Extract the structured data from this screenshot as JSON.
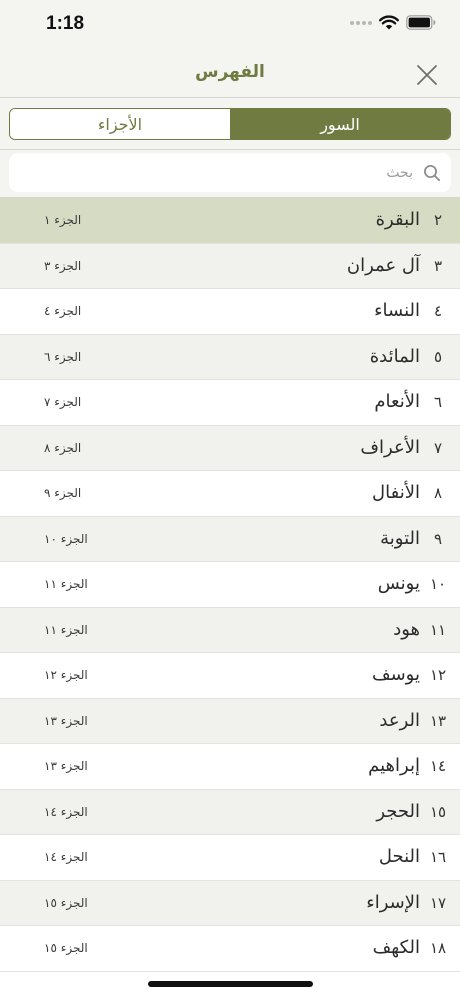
{
  "status": {
    "time": "1:18"
  },
  "header": {
    "title": "الفهرس"
  },
  "tabs": [
    {
      "label": "الأجزاء",
      "active": false
    },
    {
      "label": "السور",
      "active": true
    }
  ],
  "search": {
    "placeholder": "بحث",
    "value": ""
  },
  "colors": {
    "accent": "#6f7b41",
    "selected_row": "#d6dcc4",
    "alt_row": "#f1f1ee"
  },
  "surahs": [
    {
      "num": "٢",
      "name": "البقرة",
      "juz": "الجزء ١",
      "selected": true
    },
    {
      "num": "٣",
      "name": "آل عمران",
      "juz": "الجزء ٣"
    },
    {
      "num": "٤",
      "name": "النساء",
      "juz": "الجزء ٤"
    },
    {
      "num": "٥",
      "name": "المائدة",
      "juz": "الجزء ٦"
    },
    {
      "num": "٦",
      "name": "الأنعام",
      "juz": "الجزء ٧"
    },
    {
      "num": "٧",
      "name": "الأعراف",
      "juz": "الجزء ٨"
    },
    {
      "num": "٨",
      "name": "الأنفال",
      "juz": "الجزء ٩"
    },
    {
      "num": "٩",
      "name": "التوبة",
      "juz": "الجزء ١٠"
    },
    {
      "num": "١٠",
      "name": "يونس",
      "juz": "الجزء ١١"
    },
    {
      "num": "١١",
      "name": "هود",
      "juz": "الجزء ١١"
    },
    {
      "num": "١٢",
      "name": "يوسف",
      "juz": "الجزء ١٢"
    },
    {
      "num": "١٣",
      "name": "الرعد",
      "juz": "الجزء ١٣"
    },
    {
      "num": "١٤",
      "name": "إبراهيم",
      "juz": "الجزء ١٣"
    },
    {
      "num": "١٥",
      "name": "الحجر",
      "juz": "الجزء ١٤"
    },
    {
      "num": "١٦",
      "name": "النحل",
      "juz": "الجزء ١٤"
    },
    {
      "num": "١٧",
      "name": "الإسراء",
      "juz": "الجزء ١٥"
    },
    {
      "num": "١٨",
      "name": "الكهف",
      "juz": "الجزء ١٥"
    }
  ]
}
